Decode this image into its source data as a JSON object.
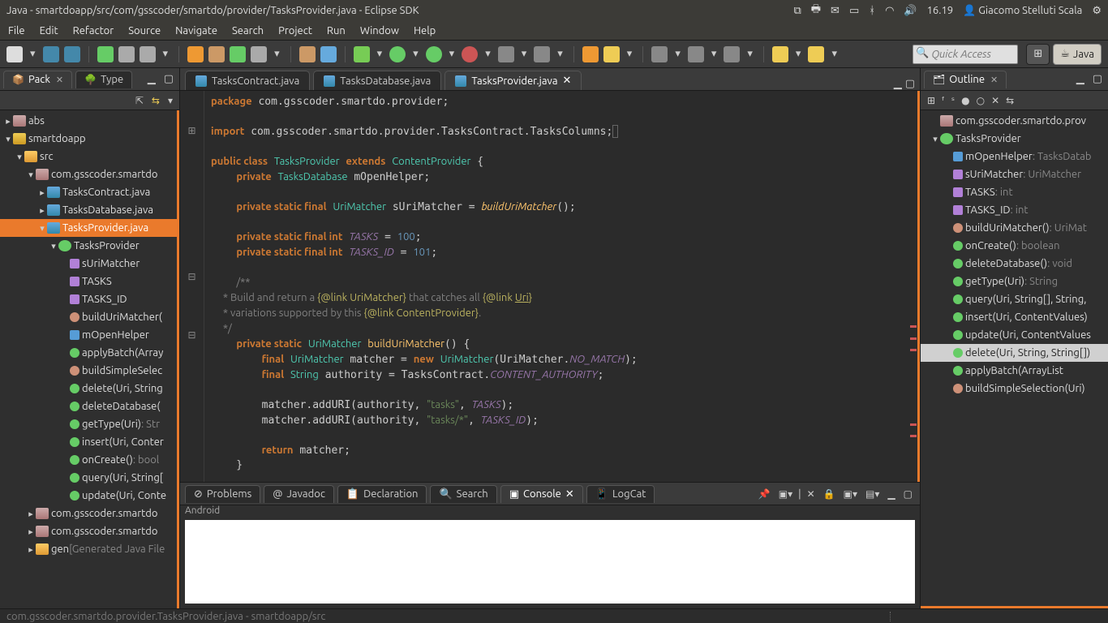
{
  "os": {
    "title": "Java - smartdoapp/src/com/gsscoder/smartdo/provider/TasksProvider.java - Eclipse SDK",
    "time": "16.19",
    "user": "Giacomo Stelluti Scala"
  },
  "menu": [
    "File",
    "Edit",
    "Refactor",
    "Source",
    "Navigate",
    "Search",
    "Project",
    "Run",
    "Window",
    "Help"
  ],
  "quick_placeholder": "Quick Access",
  "perspectives": {
    "java": "Java"
  },
  "left": {
    "tabs": {
      "pack": "Pack",
      "type": "Type"
    },
    "tree": [
      {
        "d": 0,
        "tw": "▸",
        "ic": "ic-pkg",
        "t": "abs"
      },
      {
        "d": 0,
        "tw": "▾",
        "ic": "ic-proj",
        "t": "smartdoapp"
      },
      {
        "d": 1,
        "tw": "▾",
        "ic": "ic-src",
        "t": "src"
      },
      {
        "d": 2,
        "tw": "▾",
        "ic": "ic-pkg",
        "t": "com.gsscoder.smartdo"
      },
      {
        "d": 3,
        "tw": "▸",
        "ic": "ic-java",
        "t": "TasksContract.java"
      },
      {
        "d": 3,
        "tw": "▸",
        "ic": "ic-java",
        "t": "TasksDatabase.java"
      },
      {
        "d": 3,
        "tw": "▾",
        "ic": "ic-java",
        "t": "TasksProvider.java",
        "sel": true
      },
      {
        "d": 4,
        "tw": "▾",
        "ic": "ic-cls",
        "t": "TasksProvider"
      },
      {
        "d": 5,
        "tw": "",
        "ic": "ic-sfld",
        "t": "sUriMatcher"
      },
      {
        "d": 5,
        "tw": "",
        "ic": "ic-sfld",
        "t": "TASKS"
      },
      {
        "d": 5,
        "tw": "",
        "ic": "ic-sfld",
        "t": "TASKS_ID"
      },
      {
        "d": 5,
        "tw": "",
        "ic": "ic-smeth",
        "t": "buildUriMatcher("
      },
      {
        "d": 5,
        "tw": "",
        "ic": "ic-fld",
        "t": "mOpenHelper"
      },
      {
        "d": 5,
        "tw": "",
        "ic": "ic-meth",
        "t": "applyBatch(Array"
      },
      {
        "d": 5,
        "tw": "",
        "ic": "ic-smeth",
        "t": "buildSimpleSelec"
      },
      {
        "d": 5,
        "tw": "",
        "ic": "ic-meth",
        "t": "delete(Uri, String"
      },
      {
        "d": 5,
        "tw": "",
        "ic": "ic-meth",
        "t": "deleteDatabase("
      },
      {
        "d": 5,
        "tw": "",
        "ic": "ic-meth",
        "t": "getType(Uri)",
        "rt": " : Str"
      },
      {
        "d": 5,
        "tw": "",
        "ic": "ic-meth",
        "t": "insert(Uri, Conter"
      },
      {
        "d": 5,
        "tw": "",
        "ic": "ic-meth",
        "t": "onCreate()",
        "rt": " : bool"
      },
      {
        "d": 5,
        "tw": "",
        "ic": "ic-meth",
        "t": "query(Uri, String["
      },
      {
        "d": 5,
        "tw": "",
        "ic": "ic-meth",
        "t": "update(Uri, Conte"
      },
      {
        "d": 2,
        "tw": "▸",
        "ic": "ic-pkg",
        "t": "com.gsscoder.smartdo"
      },
      {
        "d": 2,
        "tw": "▸",
        "ic": "ic-pkg",
        "t": "com.gsscoder.smartdo"
      },
      {
        "d": 2,
        "tw": "▸",
        "ic": "ic-src",
        "t": "gen",
        "rt": " [Generated Java File"
      }
    ]
  },
  "editor": {
    "tabs": [
      {
        "label": "TasksContract.java",
        "active": false
      },
      {
        "label": "TasksDatabase.java",
        "active": false
      },
      {
        "label": "TasksProvider.java",
        "active": true
      }
    ]
  },
  "outline": {
    "title": "Outline",
    "items": [
      {
        "d": 0,
        "ic": "ic-pkg",
        "t": "com.gsscoder.smartdo.prov"
      },
      {
        "d": 0,
        "ic": "ic-cls",
        "t": "TasksProvider",
        "tw": "▾"
      },
      {
        "d": 1,
        "ic": "ic-fld",
        "t": "mOpenHelper",
        "rt": " : TasksDatab"
      },
      {
        "d": 1,
        "ic": "ic-sfld",
        "t": "sUriMatcher",
        "rt": " : UriMatcher"
      },
      {
        "d": 1,
        "ic": "ic-sfld",
        "t": "TASKS",
        "rt": " : int"
      },
      {
        "d": 1,
        "ic": "ic-sfld",
        "t": "TASKS_ID",
        "rt": " : int"
      },
      {
        "d": 1,
        "ic": "ic-smeth",
        "t": "buildUriMatcher()",
        "rt": " : UriMat"
      },
      {
        "d": 1,
        "ic": "ic-meth",
        "t": "onCreate()",
        "rt": " : boolean"
      },
      {
        "d": 1,
        "ic": "ic-meth",
        "t": "deleteDatabase()",
        "rt": " : void"
      },
      {
        "d": 1,
        "ic": "ic-meth",
        "t": "getType(Uri)",
        "rt": " : String"
      },
      {
        "d": 1,
        "ic": "ic-meth",
        "t": "query(Uri, String[], String,"
      },
      {
        "d": 1,
        "ic": "ic-meth",
        "t": "insert(Uri, ContentValues)"
      },
      {
        "d": 1,
        "ic": "ic-meth",
        "t": "update(Uri, ContentValues"
      },
      {
        "d": 1,
        "ic": "ic-meth",
        "t": "delete(Uri, String, String[])",
        "sel": true
      },
      {
        "d": 1,
        "ic": "ic-meth",
        "t": "applyBatch(ArrayList<Con"
      },
      {
        "d": 1,
        "ic": "ic-smeth",
        "t": "buildSimpleSelection(Uri)"
      }
    ]
  },
  "bottom": {
    "tabs": [
      {
        "label": "Problems",
        "icon": "⊘"
      },
      {
        "label": "Javadoc",
        "icon": "@"
      },
      {
        "label": "Declaration",
        "icon": "📋"
      },
      {
        "label": "Search",
        "icon": "🔍"
      },
      {
        "label": "Console",
        "icon": "▣",
        "active": true
      },
      {
        "label": "LogCat",
        "icon": "📱"
      }
    ],
    "console_title": "Android"
  },
  "status": "com.gsscoder.smartdo.provider.TasksProvider.java - smartdoapp/src"
}
